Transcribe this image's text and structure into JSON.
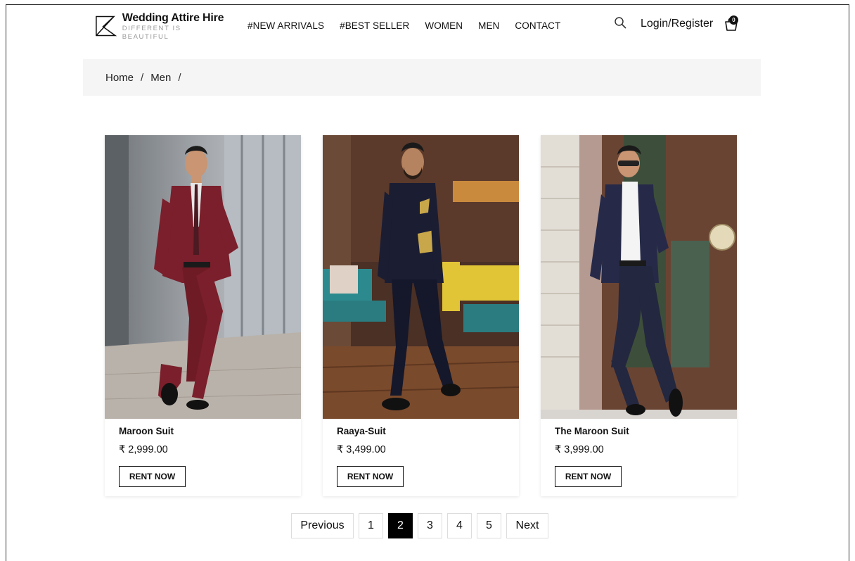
{
  "brand": {
    "name": "Wedding Attire Hire",
    "tagline": "DIFFERENT IS BEAUTIFUL"
  },
  "nav": {
    "items": [
      {
        "label": "#NEW ARRIVALS"
      },
      {
        "label": "#BEST SELLER"
      },
      {
        "label": "WOMEN"
      },
      {
        "label": "MEN"
      },
      {
        "label": "CONTACT"
      }
    ],
    "login_label": "Login/Register",
    "cart_count": "0",
    "search_icon": "search-icon",
    "cart_icon": "shopping-bag-icon"
  },
  "breadcrumb": {
    "items": [
      "Home",
      "Men"
    ],
    "separator": "/"
  },
  "products": [
    {
      "title": "Maroon Suit",
      "price": "₹ 2,999.00",
      "button": "RENT NOW",
      "suit_color": "#7a1f2b"
    },
    {
      "title": "Raaya-Suit",
      "price": "₹ 3,499.00",
      "button": "RENT NOW",
      "suit_color": "#1b1d33"
    },
    {
      "title": "The Maroon Suit",
      "price": "₹ 3,999.00",
      "button": "RENT NOW",
      "suit_color": "#262a48"
    }
  ],
  "pagination": {
    "previous": "Previous",
    "pages": [
      "1",
      "2",
      "3",
      "4",
      "5"
    ],
    "current": "2",
    "next": "Next"
  }
}
